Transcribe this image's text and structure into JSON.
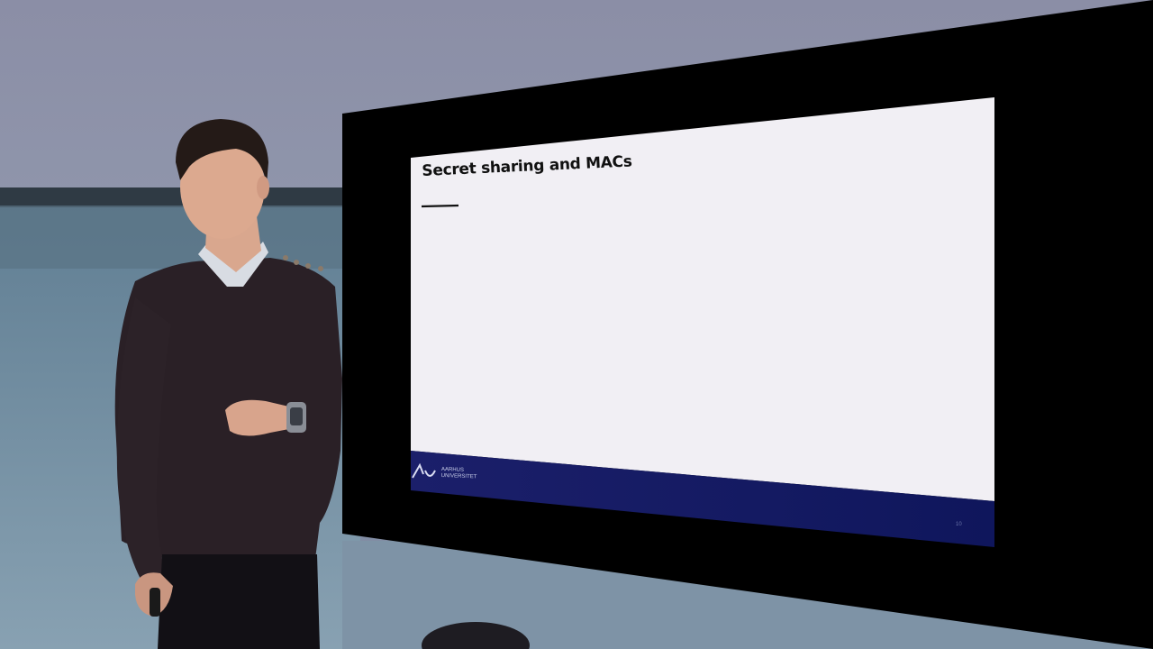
{
  "slide": {
    "title": "Secret sharing and MACs",
    "logo_line1": "AARHUS",
    "logo_line2": "UNIVERSITET",
    "page_number": "10"
  },
  "colors": {
    "slide_background": "#f1eff4",
    "footer_band": "#14185c",
    "screen_frame": "#000000",
    "wall": "#8a93a8"
  }
}
